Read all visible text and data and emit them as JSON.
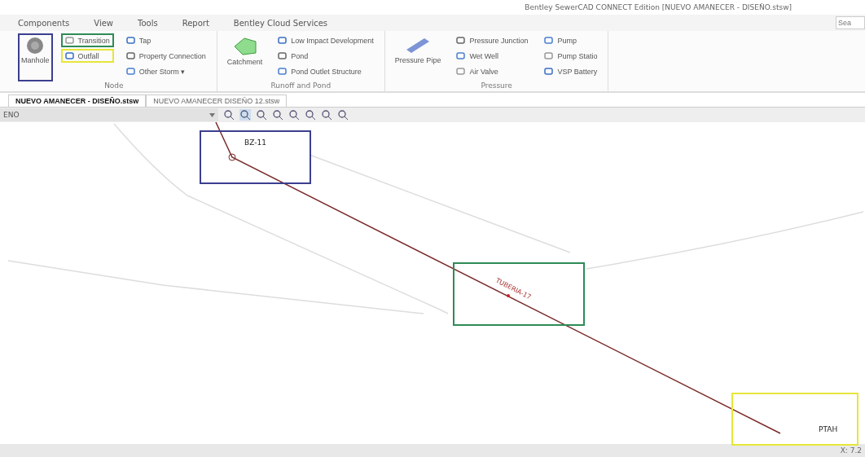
{
  "window": {
    "title": "Bentley SewerCAD CONNECT Edition [NUEVO AMANECER - DISEÑO.stsw]"
  },
  "menu": [
    "Components",
    "View",
    "Tools",
    "Report",
    "Bentley Cloud Services"
  ],
  "search": {
    "placeholder": "Sea"
  },
  "ribbon": [
    {
      "title": "Node",
      "large": "Manhole",
      "columns": [
        [
          "Transition",
          "Outfall"
        ],
        [
          "Tap",
          "Property Connection",
          "Other Storm ▾"
        ]
      ]
    },
    {
      "title": "Runoff and Pond",
      "large": "Catchment",
      "columns": [
        [
          "Low Impact Development",
          "Pond",
          "Pond Outlet Structure"
        ]
      ]
    },
    {
      "title": "Pressure",
      "large": "Pressure Pipe",
      "columns": [
        [
          "Pressure Junction",
          "Wet Well",
          "Air Valve"
        ],
        [
          "Pump",
          "Pump Statio",
          "VSP Battery"
        ]
      ]
    }
  ],
  "doc_tabs": [
    {
      "label": "NUEVO AMANECER - DISEÑO.stsw",
      "selected": true
    },
    {
      "label": "NUEVO AMANECER DISEÑO 12.stsw",
      "selected": false
    }
  ],
  "scenario": {
    "value": "ENO"
  },
  "drawing": {
    "node_label": "BZ-11",
    "pipe_label": "TUBERIA-17",
    "outfall_label": "PTAH"
  },
  "status_bar": {
    "coordinates": "X: 7.2"
  },
  "highlights": [
    {
      "color": "#3b3f8f"
    },
    {
      "color": "#2e8b57"
    },
    {
      "color": "#e6e63a"
    },
    {
      "color": "#3b3f8f"
    },
    {
      "color": "#2e8b57"
    },
    {
      "color": "#e6e63a"
    }
  ]
}
